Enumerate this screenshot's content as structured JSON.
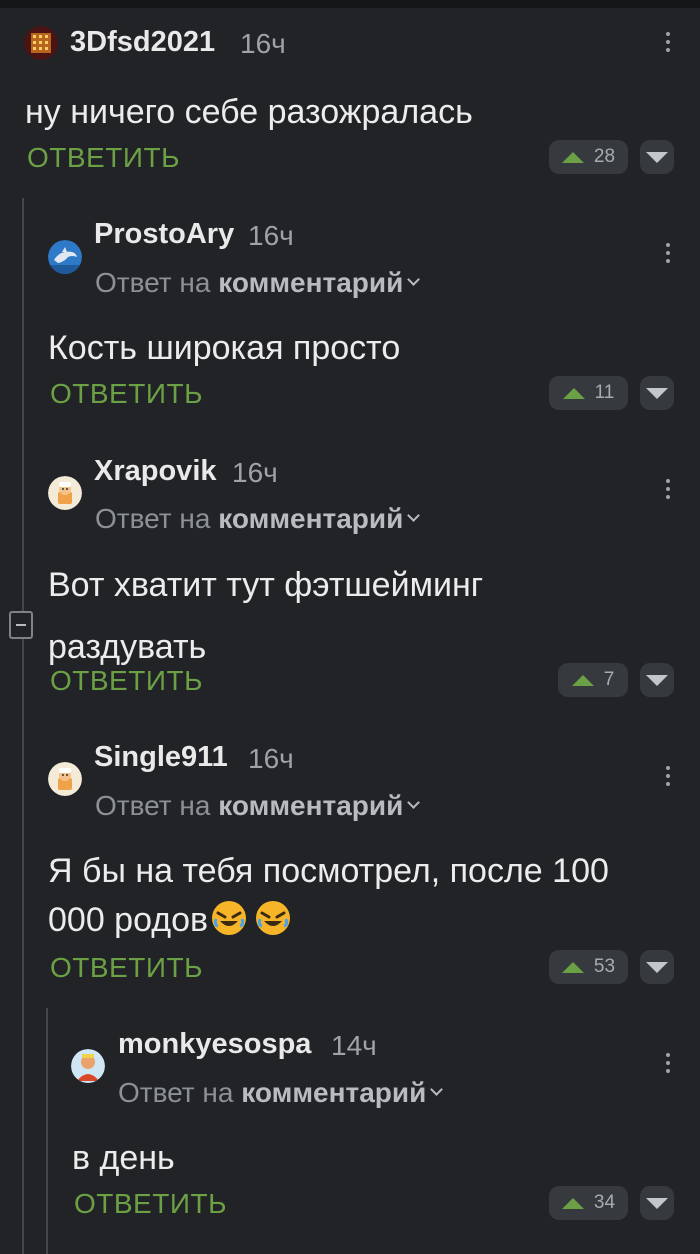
{
  "comments": [
    {
      "author": "3Dfsd2021",
      "time": "16ч",
      "reply_to": null,
      "text_lines": [
        "ну ничего себе разожралась"
      ],
      "reply_label": "ОТВЕТИТЬ",
      "rating": "28",
      "avatar_icon": "grid-avatar-icon"
    },
    {
      "author": "ProstoAry",
      "time": "16ч",
      "reply_to": {
        "prefix": "Ответ на",
        "link": "комментарий"
      },
      "text_lines": [
        "Кость широкая просто"
      ],
      "reply_label": "ОТВЕТИТЬ",
      "rating": "11",
      "avatar_icon": "dolphin-avatar-icon"
    },
    {
      "author": "Xrapovik",
      "time": "16ч",
      "reply_to": {
        "prefix": "Ответ на",
        "link": "комментарий"
      },
      "text_lines": [
        "Вот хватит тут фэтшейминг",
        "раздувать"
      ],
      "reply_label": "ОТВЕТИТЬ",
      "rating": "7",
      "avatar_icon": "cartoon-avatar-icon"
    },
    {
      "author": "Single911",
      "time": "16ч",
      "reply_to": {
        "prefix": "Ответ на",
        "link": "комментарий"
      },
      "text_lines": [
        "Я бы на тебя посмотрел, после 100",
        "000 родов"
      ],
      "emoji": [
        "rolling-laughing-emoji",
        "rolling-laughing-emoji"
      ],
      "reply_label": "ОТВЕТИТЬ",
      "rating": "53",
      "avatar_icon": "cartoon-avatar-icon"
    },
    {
      "author": "monkyesospa",
      "time": "14ч",
      "reply_to": {
        "prefix": "Ответ на",
        "link": "комментарий"
      },
      "text_lines": [
        "в день"
      ],
      "reply_label": "ОТВЕТИТЬ",
      "rating": "34",
      "avatar_icon": "person-avatar-icon"
    }
  ],
  "colors": {
    "background": "#212326",
    "reply_green": "#6ca045",
    "thread_line": "#44474c"
  }
}
